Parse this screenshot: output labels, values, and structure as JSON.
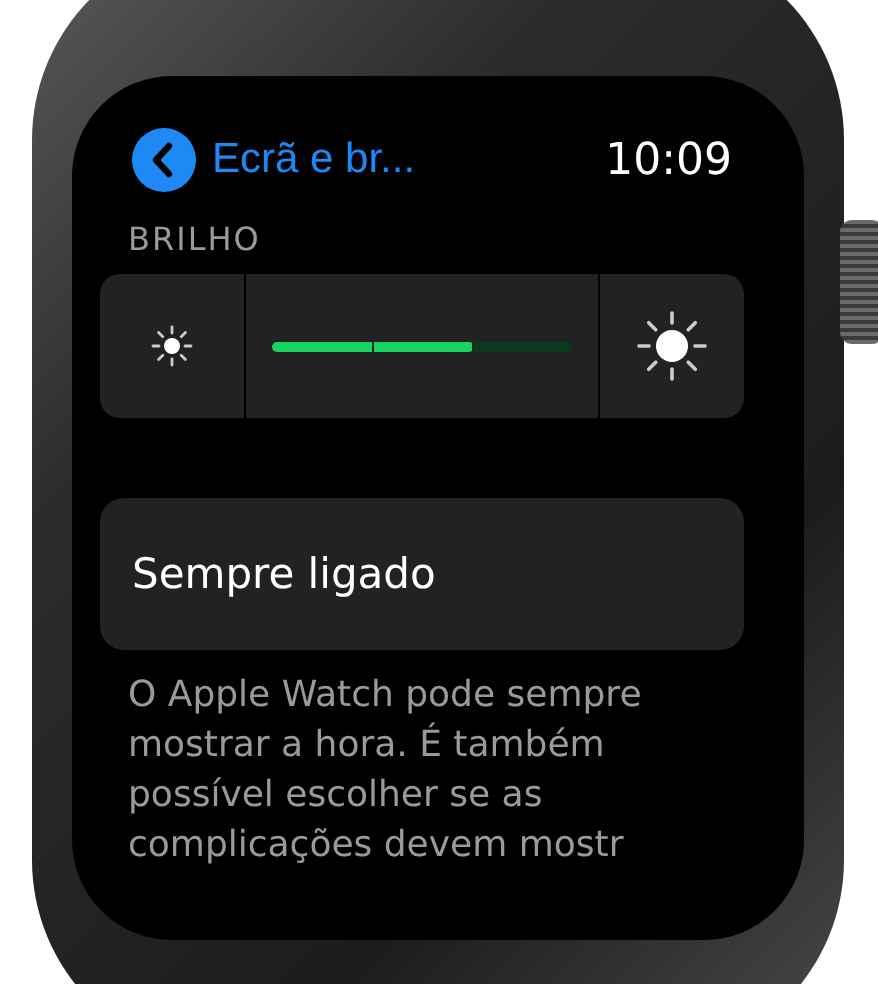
{
  "header": {
    "back_title": "Ecrã e br...",
    "time": "10:09"
  },
  "brightness": {
    "label": "BRILHO",
    "level": 0.67
  },
  "always_on": {
    "label": "Sempre ligado"
  },
  "description": "O Apple Watch pode sempre mostrar a hora. É também possível escolher se as complicações devem mostr"
}
